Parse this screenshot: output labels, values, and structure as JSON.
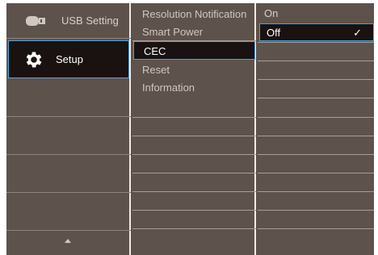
{
  "left_menu": {
    "items": [
      {
        "label": "USB Setting",
        "icon": "usb-icon",
        "selected": false
      },
      {
        "label": "Setup",
        "icon": "gear-icon",
        "selected": true
      }
    ],
    "scroll_indicator": "up-arrow-icon"
  },
  "mid_menu": {
    "items": [
      {
        "label": "Resolution Notification",
        "selected": false
      },
      {
        "label": "Smart Power",
        "selected": false
      },
      {
        "label": "CEC",
        "selected": true
      },
      {
        "label": "Reset",
        "selected": false
      },
      {
        "label": "Information",
        "selected": false
      }
    ]
  },
  "options": {
    "items": [
      {
        "label": "On",
        "selected": false
      },
      {
        "label": "Off",
        "selected": true
      }
    ],
    "check_mark": "✓"
  },
  "colors": {
    "background": "#5d524c",
    "highlight": "#1a1210",
    "border_accent": "#4aa4dc"
  }
}
